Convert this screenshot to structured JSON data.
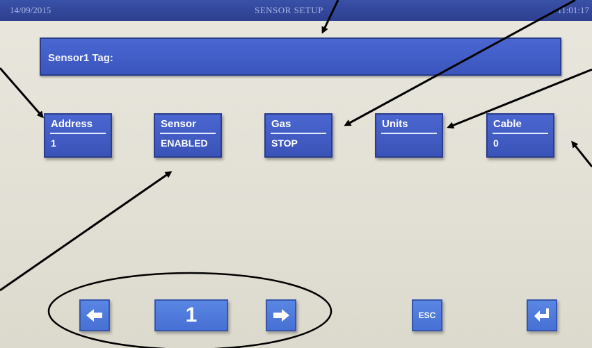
{
  "header": {
    "date": "14/09/2015",
    "title": "SENSOR SETUP",
    "time": "11:01:17"
  },
  "tag": {
    "label": "Sensor1 Tag:"
  },
  "fields": [
    {
      "name": "Address",
      "value": "1"
    },
    {
      "name": "Sensor",
      "value": "ENABLED"
    },
    {
      "name": "Gas",
      "value": "STOP"
    },
    {
      "name": "Units",
      "value": ""
    },
    {
      "name": "Cable",
      "value": "0"
    }
  ],
  "nav": {
    "page": "1",
    "prev_icon": "arrow-left-icon",
    "next_icon": "arrow-right-icon",
    "esc_label": "ESC",
    "enter_icon": "enter-return-icon"
  },
  "colors": {
    "title_bar": "#2d3f8f",
    "button_blue": "#3f5ac4",
    "nav_blue": "#4f7bdc",
    "screen_bg": "#e6e4da",
    "annotation": "#000000"
  }
}
